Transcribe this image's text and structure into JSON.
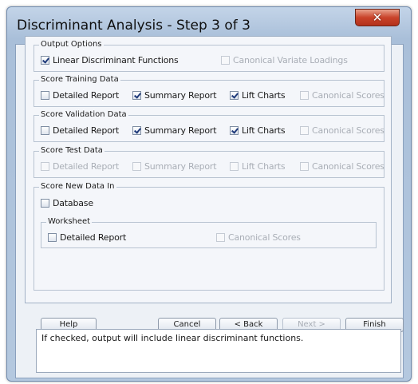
{
  "window": {
    "title": "Discriminant Analysis - Step 3 of 3"
  },
  "output_options": {
    "legend": "Output Options",
    "linear_discriminant_functions": {
      "label": "Linear Discriminant Functions",
      "checked": true
    },
    "canonical_variate_loadings": {
      "label": "Canonical Variate Loadings",
      "checked": false,
      "disabled": true
    }
  },
  "score_training": {
    "legend": "Score Training Data",
    "detailed_report": {
      "label": "Detailed Report",
      "checked": false
    },
    "summary_report": {
      "label": "Summary Report",
      "checked": true
    },
    "lift_charts": {
      "label": "Lift Charts",
      "checked": true
    },
    "canonical_scores": {
      "label": "Canonical Scores",
      "checked": false,
      "disabled": true
    }
  },
  "score_validation": {
    "legend": "Score Validation Data",
    "detailed_report": {
      "label": "Detailed Report",
      "checked": false
    },
    "summary_report": {
      "label": "Summary Report",
      "checked": true
    },
    "lift_charts": {
      "label": "Lift Charts",
      "checked": true
    },
    "canonical_scores": {
      "label": "Canonical Scores",
      "checked": false,
      "disabled": true
    }
  },
  "score_test": {
    "legend": "Score Test Data",
    "detailed_report": {
      "label": "Detailed Report",
      "checked": false,
      "disabled": true
    },
    "summary_report": {
      "label": "Summary Report",
      "checked": false,
      "disabled": true
    },
    "lift_charts": {
      "label": "Lift Charts",
      "checked": false,
      "disabled": true
    },
    "canonical_scores": {
      "label": "Canonical Scores",
      "checked": false,
      "disabled": true
    }
  },
  "score_new": {
    "legend": "Score New Data In",
    "database": {
      "label": "Database",
      "checked": false
    },
    "worksheet": {
      "legend": "Worksheet",
      "detailed_report": {
        "label": "Detailed Report",
        "checked": false
      },
      "canonical_scores": {
        "label": "Canonical Scores",
        "checked": false,
        "disabled": true
      }
    }
  },
  "buttons": {
    "help": "Help",
    "cancel": "Cancel",
    "back": "< Back",
    "next": "Next >",
    "finish": "Finish"
  },
  "status_text": "If checked, output will include linear discriminant functions."
}
